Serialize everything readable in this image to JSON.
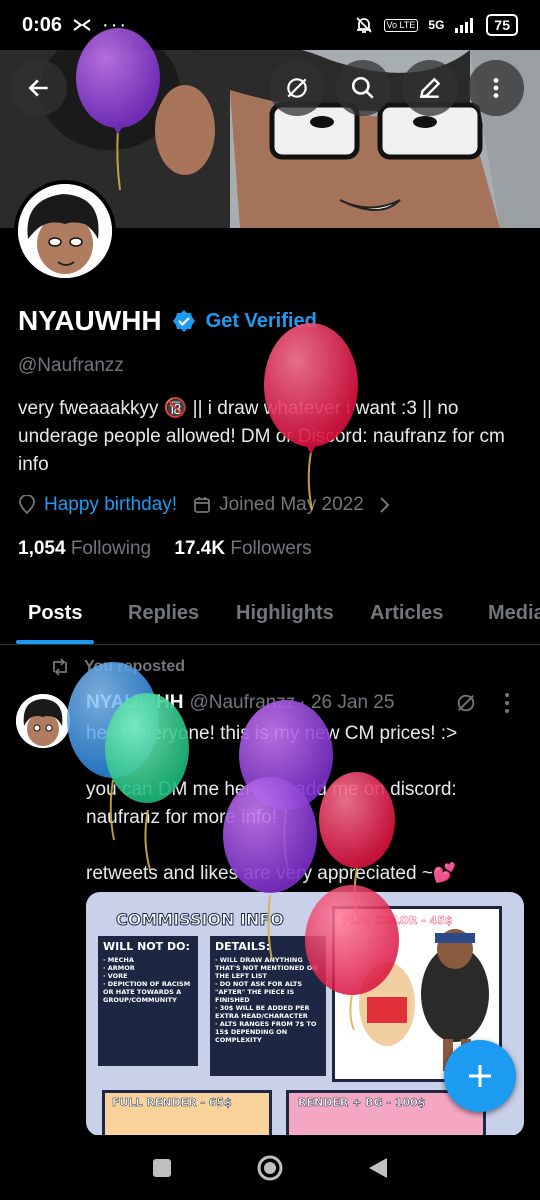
{
  "status_bar": {
    "time": "0:06",
    "network": "5G",
    "lte": "Vo LTE",
    "battery": "75"
  },
  "profile": {
    "name": "NYAUWHH",
    "get_verified": "Get Verified",
    "handle": "@Naufranzz",
    "bio": "very fweaaakkyy 🔞 || i draw whatever i want :3 || no underage people allowed!  DM or Discord: naufranz for cm info",
    "birthday": "Happy birthday!",
    "joined": "Joined May 2022",
    "following_count": "1,054",
    "following_label": "Following",
    "followers_count": "17.4K",
    "followers_label": "Followers"
  },
  "tabs": [
    "Posts",
    "Replies",
    "Highlights",
    "Articles",
    "Media"
  ],
  "tweet": {
    "repost_label": "You reposted",
    "name": "NYAUWHH",
    "handle": "@Naufranzz",
    "date": "· 26 Jan 25",
    "line1": "hello everyone! this is my new CM prices! :>",
    "line2": "you can DM me here, or add me on discord: naufranz for more info!",
    "line3": "retweets and likes are very appreciated ~💕"
  },
  "commission": {
    "title": "COMMISSION INFO",
    "will_not_do_title": "WILL NOT DO:",
    "will_not_do": [
      "· MECHA",
      "· ARMOR",
      "· VORE",
      "· DEPICTION OF RACISM OR HATE TOWARDS A GROUP/COMMUNITY"
    ],
    "details_title": "DETAILS:",
    "details": [
      "· WILL DRAW ANYTHING THAT'S NOT MENTIONED ON THE LEFT LIST",
      "· DO NOT ASK FOR ALTS \"AFTER\" THE PIECE IS FINISHED",
      "· 30$ WILL BE ADDED PER EXTRA HEAD/CHARACTER",
      "· ALTS RANGES FROM 7$ TO 15$ DEPENDING ON COMPLEXITY"
    ],
    "flat_color": "FLAT COLOR - 45$",
    "full_render": "FULL RENDER - 65$",
    "render_bg": "RENDER + BG - 100$"
  },
  "colors": {
    "accent": "#1d9bf0",
    "muted": "#71767b",
    "background": "#000000"
  },
  "icons": [
    "back-arrow-icon",
    "grok-icon",
    "search-icon",
    "edit-icon",
    "more-vertical-icon",
    "verified-badge-icon",
    "location-icon",
    "calendar-icon",
    "chevron-right-icon",
    "repost-icon",
    "plus-icon"
  ]
}
